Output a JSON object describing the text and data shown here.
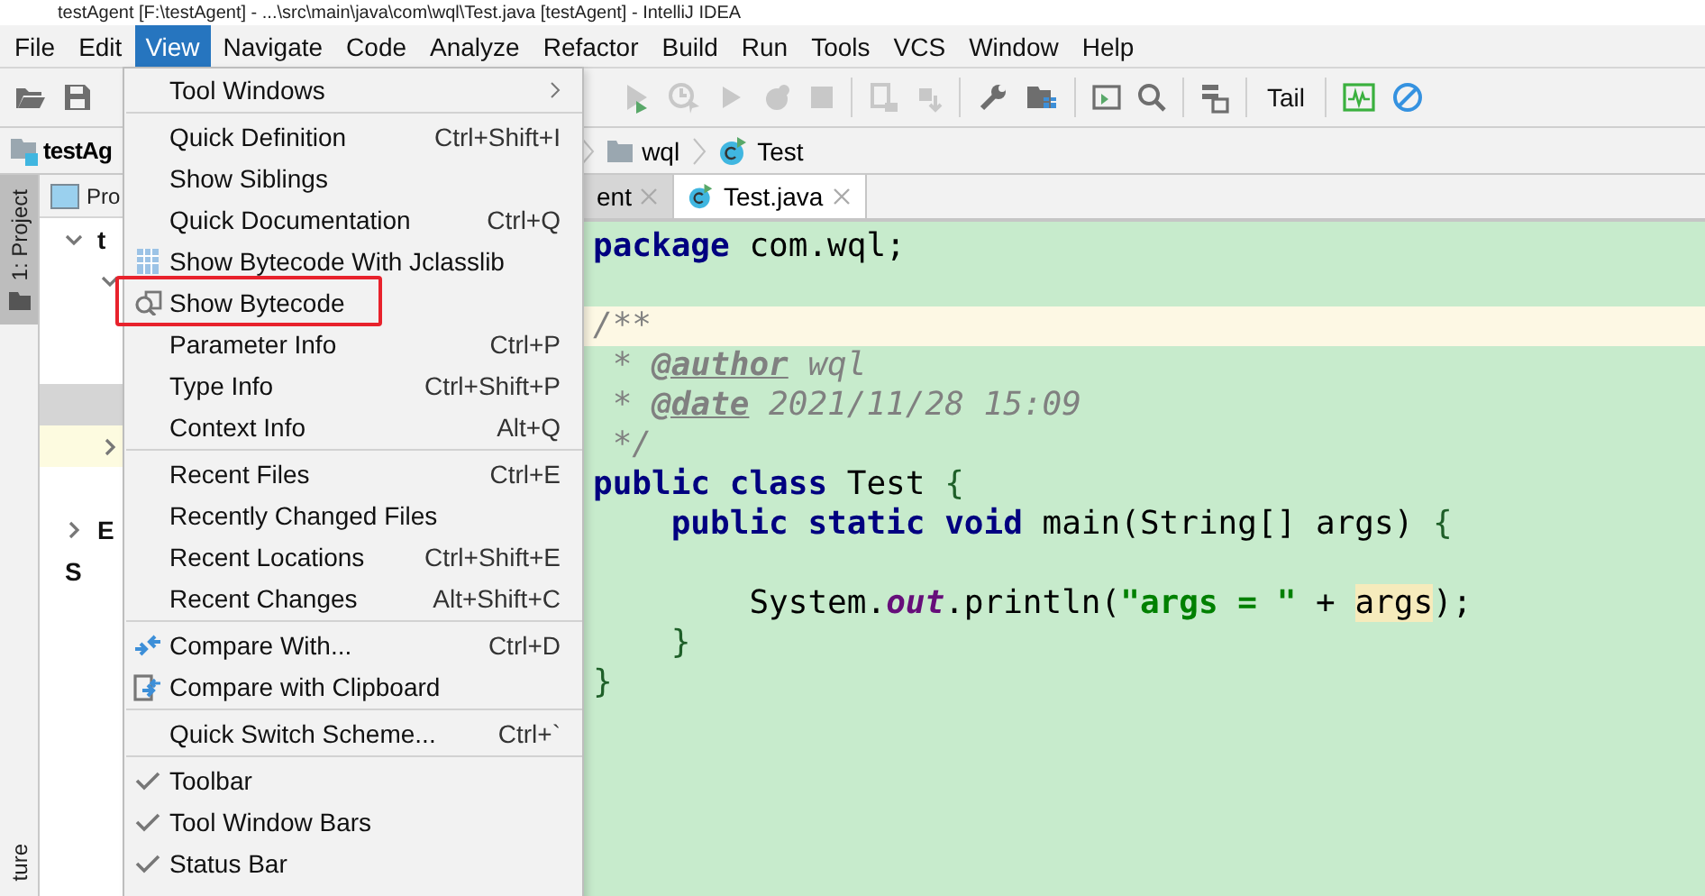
{
  "window": {
    "title": "testAgent [F:\\testAgent] - ...\\src\\main\\java\\com\\wql\\Test.java [testAgent] - IntelliJ IDEA"
  },
  "menubar": [
    {
      "label": "File",
      "selected": false
    },
    {
      "label": "Edit",
      "selected": false
    },
    {
      "label": "View",
      "selected": true
    },
    {
      "label": "Navigate",
      "selected": false
    },
    {
      "label": "Code",
      "selected": false
    },
    {
      "label": "Analyze",
      "selected": false
    },
    {
      "label": "Refactor",
      "selected": false
    },
    {
      "label": "Build",
      "selected": false
    },
    {
      "label": "Run",
      "selected": false
    },
    {
      "label": "Tools",
      "selected": false
    },
    {
      "label": "VCS",
      "selected": false
    },
    {
      "label": "Window",
      "selected": false
    },
    {
      "label": "Help",
      "selected": false
    }
  ],
  "toolbar": {
    "text_button": "Tail"
  },
  "navbar": {
    "project": "testAg",
    "crumbs": [
      {
        "kind": "folder",
        "label": "wql"
      },
      {
        "kind": "class",
        "label": "Test"
      }
    ]
  },
  "tool_strip": {
    "top_tab": {
      "label": "1: Project",
      "selected": true
    },
    "bottom_tab": {
      "label": "ture",
      "selected": false
    }
  },
  "project_panel": {
    "tab": "Pro",
    "rows": [
      {
        "label": "t",
        "expanded": true,
        "selected": false
      },
      {
        "expanded": true,
        "selected": false
      },
      {
        "selected": false
      },
      {
        "selected": false
      },
      {
        "selected": true
      },
      {
        "expanded": false,
        "selected": false,
        "highlighted": true
      },
      {
        "selected": false
      },
      {
        "label": "E",
        "expanded": false,
        "selected": false
      },
      {
        "label": "S",
        "selected": false
      }
    ]
  },
  "menu": {
    "items": [
      {
        "kind": "submenu",
        "label": "Tool Windows"
      },
      {
        "kind": "separator"
      },
      {
        "kind": "plain",
        "label": "Quick Definition",
        "shortcut": "Ctrl+Shift+I"
      },
      {
        "kind": "plain",
        "label": "Show Siblings"
      },
      {
        "kind": "plain",
        "label": "Quick Documentation",
        "shortcut": "Ctrl+Q"
      },
      {
        "kind": "jclasslib",
        "label": "Show Bytecode With Jclasslib"
      },
      {
        "kind": "bytecode",
        "label": "Show Bytecode",
        "highlighted": true
      },
      {
        "kind": "plain",
        "label": "Parameter Info",
        "shortcut": "Ctrl+P"
      },
      {
        "kind": "plain",
        "label": "Type Info",
        "shortcut": "Ctrl+Shift+P"
      },
      {
        "kind": "plain",
        "label": "Context Info",
        "shortcut": "Alt+Q"
      },
      {
        "kind": "separator"
      },
      {
        "kind": "plain",
        "label": "Recent Files",
        "shortcut": "Ctrl+E"
      },
      {
        "kind": "plain",
        "label": "Recently Changed Files"
      },
      {
        "kind": "plain",
        "label": "Recent Locations",
        "shortcut": "Ctrl+Shift+E"
      },
      {
        "kind": "plain",
        "label": "Recent Changes",
        "shortcut": "Alt+Shift+C"
      },
      {
        "kind": "separator"
      },
      {
        "kind": "compare",
        "label": "Compare With...",
        "shortcut": "Ctrl+D"
      },
      {
        "kind": "compare-clipboard",
        "label": "Compare with Clipboard"
      },
      {
        "kind": "separator"
      },
      {
        "kind": "plain",
        "label": "Quick Switch Scheme...",
        "shortcut": "Ctrl+`"
      },
      {
        "kind": "separator"
      },
      {
        "kind": "check",
        "label": "Toolbar",
        "checked": true
      },
      {
        "kind": "check",
        "label": "Tool Window Bars",
        "checked": true
      },
      {
        "kind": "check",
        "label": "Status Bar",
        "checked": true
      }
    ]
  },
  "editor": {
    "tabs": [
      {
        "label": "ent",
        "selected": false
      },
      {
        "label": "Test.java",
        "selected": true
      }
    ],
    "lines": [
      {
        "current": false,
        "tokens": [
          {
            "kind": "kw",
            "text": "package"
          },
          {
            "kind": "plain",
            "text": " com.wql;"
          }
        ]
      },
      {
        "current": false
      },
      {
        "current": true,
        "tokens": [
          {
            "kind": "comment",
            "text": "/**"
          }
        ]
      },
      {
        "current": false,
        "tokens": [
          {
            "kind": "comment",
            "text": " * "
          },
          {
            "kind": "doctag",
            "text": "@author"
          },
          {
            "kind": "comment",
            "text": " wql"
          }
        ]
      },
      {
        "current": false,
        "tokens": [
          {
            "kind": "comment",
            "text": " * "
          },
          {
            "kind": "doctag",
            "text": "@date"
          },
          {
            "kind": "comment",
            "text": " 2021/11/28 15:09"
          }
        ]
      },
      {
        "current": false,
        "tokens": [
          {
            "kind": "comment",
            "text": " */"
          }
        ]
      },
      {
        "current": false,
        "tokens": [
          {
            "kind": "kw",
            "text": "public class"
          },
          {
            "kind": "plain",
            "text": " Test "
          },
          {
            "kind": "brace",
            "text": "{"
          }
        ]
      },
      {
        "current": false,
        "tokens": [
          {
            "kind": "kw",
            "text": "    public static void"
          },
          {
            "kind": "plain",
            "text": " main(String[] args) "
          },
          {
            "kind": "brace",
            "text": "{"
          }
        ]
      },
      {
        "current": false
      },
      {
        "current": false,
        "tokens": [
          {
            "kind": "plain",
            "text": "        System."
          },
          {
            "kind": "field",
            "text": "out"
          },
          {
            "kind": "plain",
            "text": ".println("
          },
          {
            "kind": "string",
            "text": "\"args = \""
          },
          {
            "kind": "plain",
            "text": " + "
          },
          {
            "kind": "usage",
            "text": "args"
          },
          {
            "kind": "plain",
            "text": ");"
          }
        ]
      },
      {
        "current": false,
        "tokens": [
          {
            "kind": "brace",
            "text": "    }"
          }
        ]
      },
      {
        "current": false,
        "tokens": [
          {
            "kind": "brace",
            "text": "}"
          }
        ]
      }
    ]
  }
}
